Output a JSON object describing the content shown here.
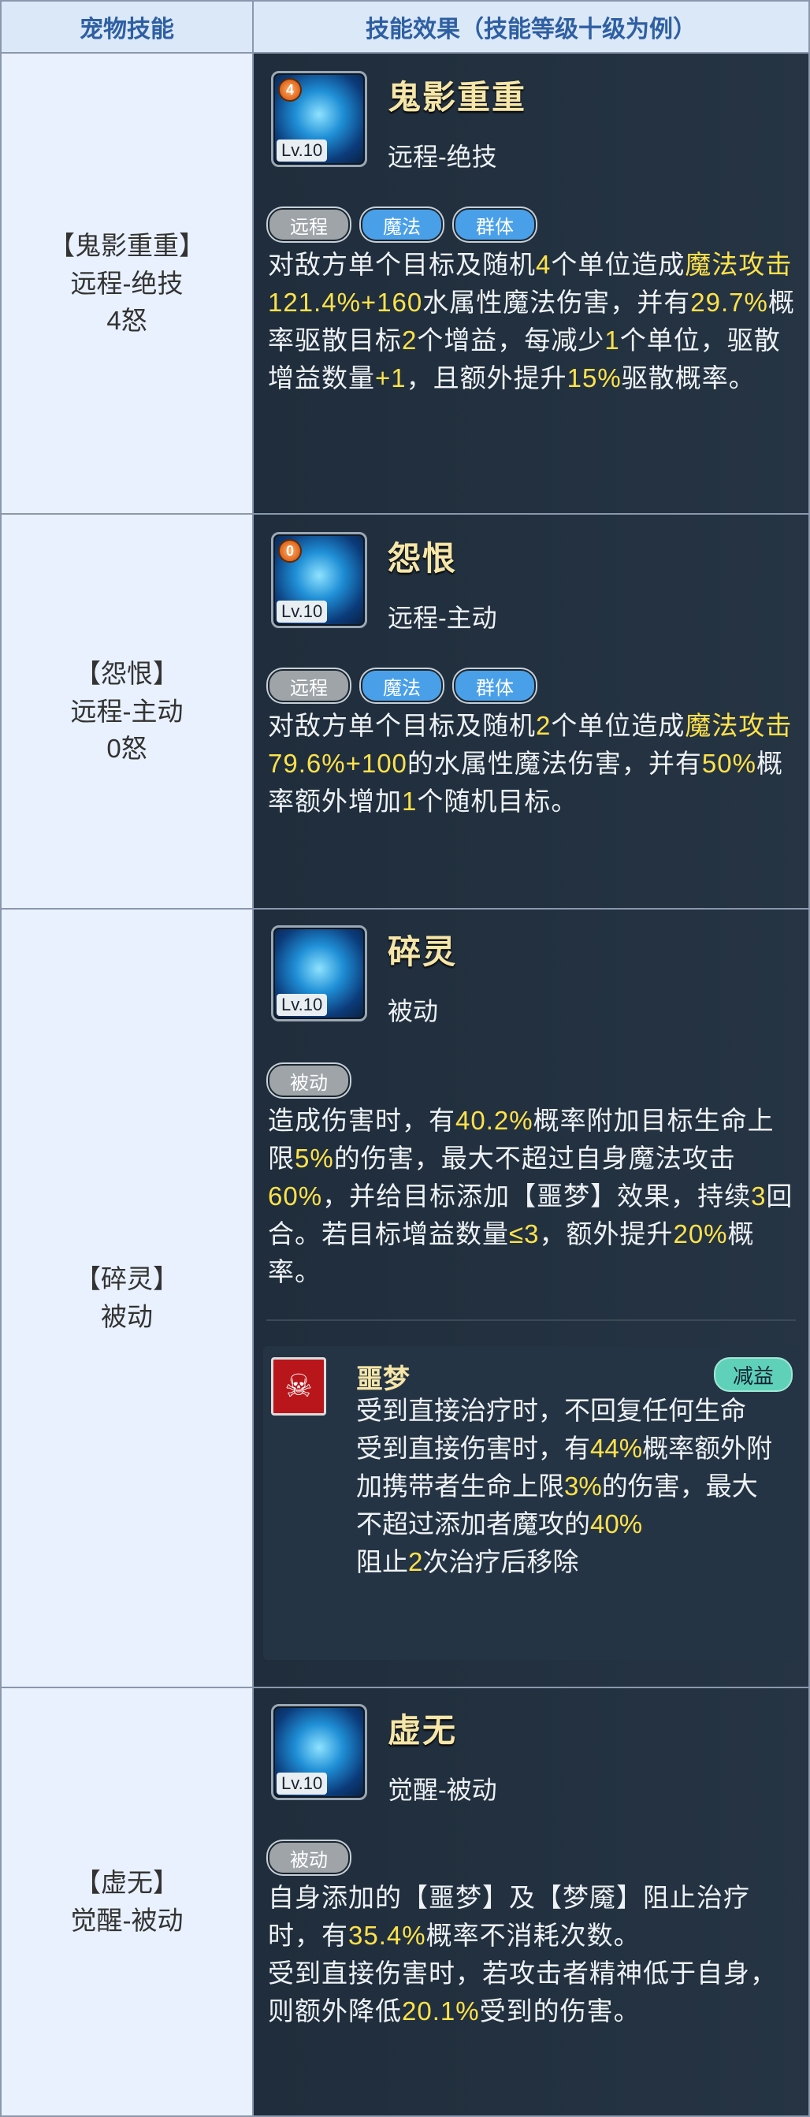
{
  "header": {
    "col1": "宠物技能",
    "col2": "技能效果（技能等级十级为例）"
  },
  "skills": [
    {
      "left": {
        "l1": "【鬼影重重】",
        "l2": "远程-绝技",
        "l3": "4怒"
      },
      "name": "鬼影重重",
      "type": "远程-绝技",
      "lv": "Lv.10",
      "rage": "4",
      "tags": [
        "远程",
        "魔法",
        "群体"
      ],
      "desc": [
        "对敌方单个目标及随机",
        "4",
        "个单位造成",
        "魔法攻击121.4%+160",
        "水属性魔法伤害，并有",
        "29.7%",
        "概率驱散目标",
        "2",
        "个增益，每减少",
        "1",
        "个单位，驱散增益数量",
        "+1",
        "，且额外提升",
        "15%",
        "驱散概率。"
      ]
    },
    {
      "left": {
        "l1": "【怨恨】",
        "l2": "远程-主动",
        "l3": "0怒"
      },
      "name": "怨恨",
      "type": "远程-主动",
      "lv": "Lv.10",
      "rage": "0",
      "tags": [
        "远程",
        "魔法",
        "群体"
      ],
      "desc": [
        "对敌方单个目标及随机",
        "2",
        "个单位造成",
        "魔法攻击79.6%+100",
        "的水属性魔法伤害，并有",
        "50%",
        "概率额外增加",
        "1",
        "个随机目标。"
      ]
    },
    {
      "left": {
        "l1": "【碎灵】",
        "l2": "被动"
      },
      "name": "碎灵",
      "type": "被动",
      "lv": "Lv.10",
      "tags": [
        "被动"
      ],
      "desc": [
        "造成伤害时，有",
        "40.2%",
        "概率附加目标生命上限",
        "5%",
        "的伤害，最大不超过自身魔法攻击",
        "60%",
        "，并给目标添加【噩梦】效果，持续",
        "3",
        "回合。若目标增益数量",
        "≤3",
        "，额外提升",
        "20%",
        "概率。"
      ],
      "effect": {
        "name": "噩梦",
        "badge": "减益",
        "desc": [
          "受到直接治疗时，不回复任何生命",
          "受到直接伤害时，有",
          "44%",
          "概率额外附加携带者生命上限",
          "3%",
          "的伤害，最大不超过添加者魔攻的",
          "40%",
          "阻止",
          "2",
          "次治疗后移除"
        ]
      }
    },
    {
      "left": {
        "l1": "【虚无】",
        "l2": "觉醒-被动"
      },
      "name": "虚无",
      "type": "觉醒-被动",
      "lv": "Lv.10",
      "tags": [
        "被动"
      ],
      "desc": [
        "自身添加的【噩梦】及【梦魇】阻止治疗时，有",
        "35.4%",
        "概率不消耗次数。",
        "受到直接伤害时，若攻击者精神低于自身，则额外降低",
        "20.1%",
        "受到的伤害。"
      ]
    }
  ]
}
